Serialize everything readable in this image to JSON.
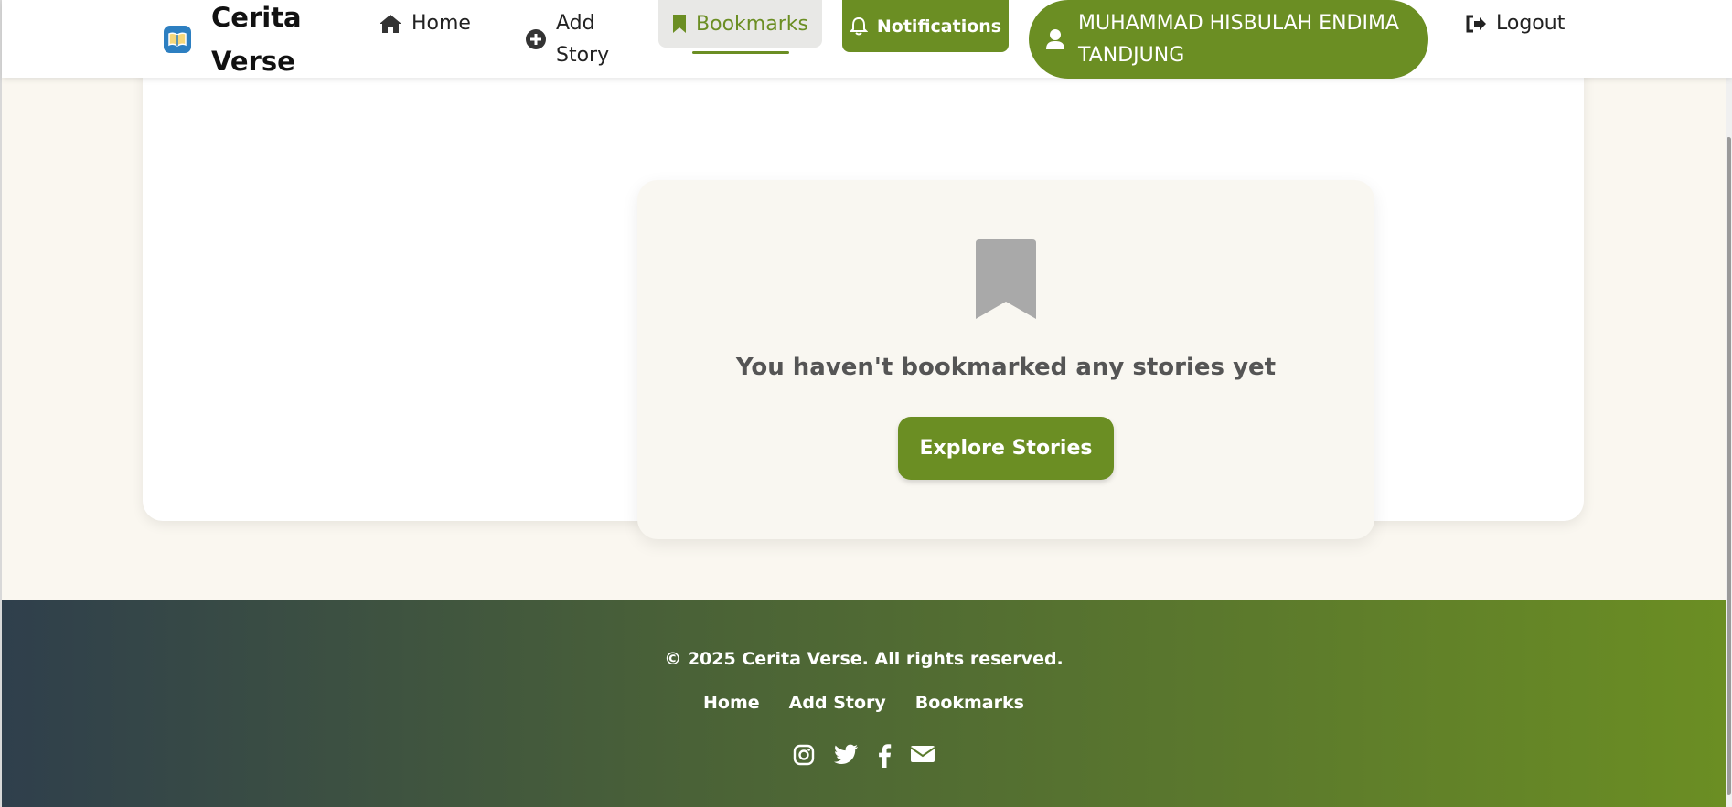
{
  "header": {
    "brand_name": "Cerita Verse",
    "nav": {
      "home": "Home",
      "add_story": "Add Story",
      "bookmarks": "Bookmarks",
      "notifications": "Notifications",
      "user": "MUHAMMAD HISBULAH ENDIMA TANDJUNG",
      "logout": "Logout"
    }
  },
  "empty_state": {
    "message": "You haven't bookmarked any stories yet",
    "button": "Explore Stories"
  },
  "footer": {
    "copyright": "© 2025 Cerita Verse. All rights reserved.",
    "links": [
      "Home",
      "Add Story",
      "Bookmarks"
    ],
    "socials": [
      "instagram-icon",
      "twitter-icon",
      "facebook-icon",
      "envelope-icon"
    ]
  },
  "colors": {
    "accent": "#6b8e23",
    "brand_icon": "#2d7fc1",
    "footer_start": "#2f3f4c",
    "background": "#faf7f0"
  }
}
